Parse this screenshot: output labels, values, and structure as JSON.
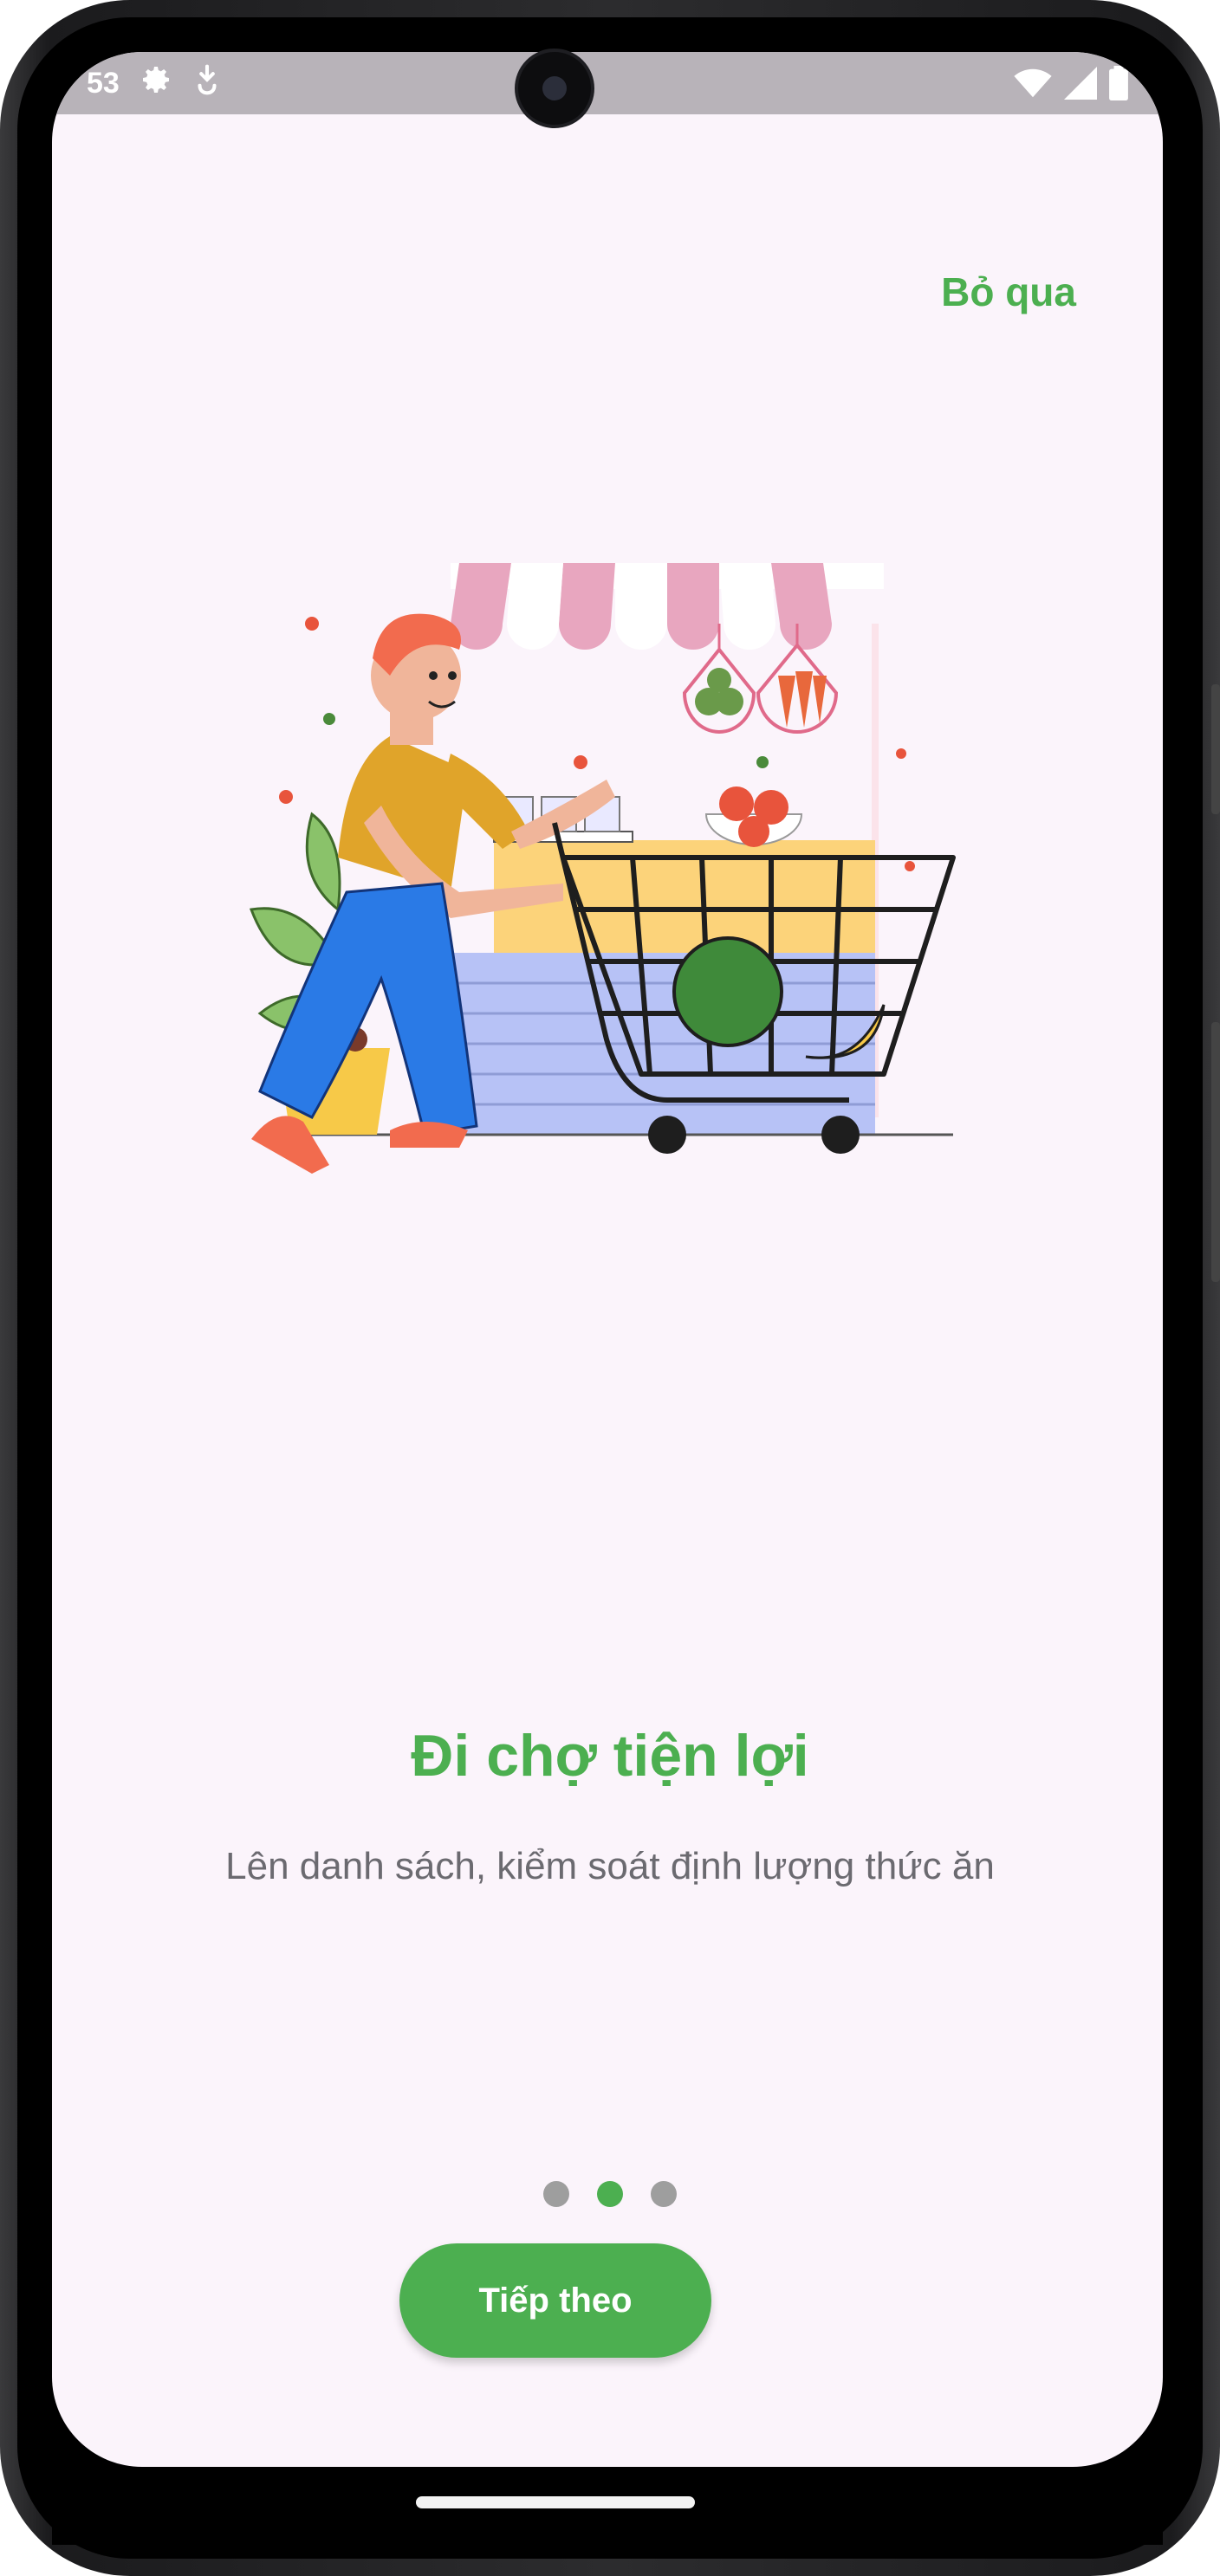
{
  "status_bar": {
    "time": "53"
  },
  "onboarding": {
    "skip_label": "Bỏ qua",
    "title": "Đi chợ tiện lợi",
    "subtitle": "Lên danh sách, kiểm soát định lượng thức ăn",
    "page_indicator": {
      "total": 3,
      "current": 2
    },
    "next_label": "Tiếp theo"
  },
  "colors": {
    "accent": "#4caf50",
    "background": "#fbf4fb",
    "dot_inactive": "#9e9e9e",
    "subtitle": "#6b6a70"
  },
  "icons": [
    "settings-icon",
    "download-icon",
    "wifi-icon",
    "signal-icon",
    "battery-icon",
    "shopping-illustration"
  ]
}
